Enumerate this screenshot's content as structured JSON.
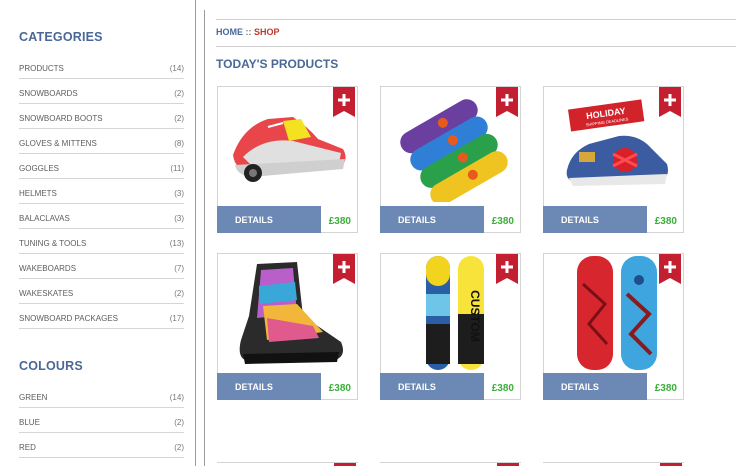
{
  "sidebar": {
    "categories_title": "CATEGORIES",
    "categories": [
      {
        "label": "PRODUCTS",
        "count": "(14)"
      },
      {
        "label": "SNOWBOARDS",
        "count": "(2)"
      },
      {
        "label": "SNOWBOARD BOOTS",
        "count": "(2)"
      },
      {
        "label": "GLOVES & MITTENS",
        "count": "(8)"
      },
      {
        "label": "GOGGLES",
        "count": "(11)"
      },
      {
        "label": "HELMETS",
        "count": "(3)"
      },
      {
        "label": "BALACLAVAS",
        "count": "(3)"
      },
      {
        "label": "TUNING & TOOLS",
        "count": "(13)"
      },
      {
        "label": "WAKEBOARDS",
        "count": "(7)"
      },
      {
        "label": "WAKESKATES",
        "count": "(2)"
      },
      {
        "label": "SNOWBOARD PACKAGES",
        "count": "(17)"
      }
    ],
    "colours_title": "COLOURS",
    "colours": [
      {
        "label": "GREEN",
        "count": "(14)"
      },
      {
        "label": "BLUE",
        "count": "(2)"
      },
      {
        "label": "RED",
        "count": "(2)"
      }
    ]
  },
  "breadcrumb": {
    "home": "HOME",
    "separator": " :: ",
    "current": "SHOP"
  },
  "main": {
    "title": "TODAY'S PRODUCTS",
    "products": [
      {
        "details": "DETAILS",
        "price": "£380",
        "icon": "sneaker-image"
      },
      {
        "details": "DETAILS",
        "price": "£380",
        "icon": "skateboard-decks-image"
      },
      {
        "details": "DETAILS",
        "price": "£380",
        "icon": "holiday-shoe-image",
        "banner_line1": "HOLIDAY",
        "banner_line2": "SHIPPING DEADLINES"
      },
      {
        "details": "DETAILS",
        "price": "£380",
        "icon": "snowboard-boot-image"
      },
      {
        "details": "DETAILS",
        "price": "£380",
        "icon": "snowboards-image",
        "board_text": "CUSTOM"
      },
      {
        "details": "DETAILS",
        "price": "£380",
        "icon": "wakeboards-image"
      }
    ]
  },
  "colors": {
    "accent": "#4a6897",
    "button": "#6c88b4",
    "price": "#3cae3c",
    "tag": "#c41f30",
    "crumb_active": "#c0392b"
  }
}
